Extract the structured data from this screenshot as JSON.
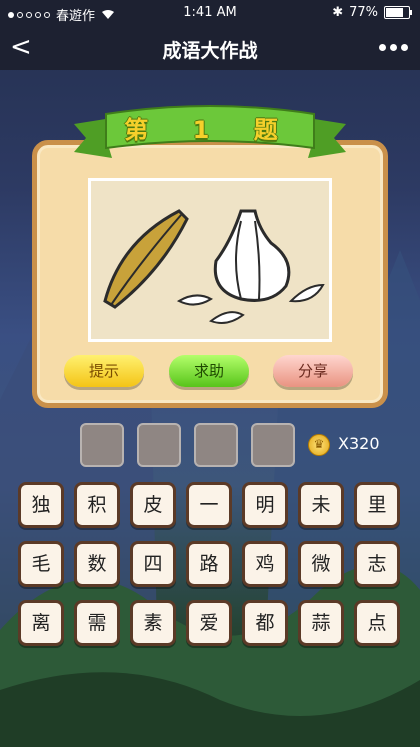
{
  "status_bar": {
    "carrier": "春遊作",
    "time": "1:41 AM",
    "battery": "77%",
    "battery_level": 0.77
  },
  "nav": {
    "back_label": "<",
    "title": "成语大作战"
  },
  "question": {
    "ribbon_label": "第 1 题"
  },
  "actions": {
    "hint": "提示",
    "help": "求助",
    "share": "分享"
  },
  "answer_slots": 4,
  "coins": {
    "label": "X320",
    "icon": "crown-coin-icon"
  },
  "tiles": [
    [
      "独",
      "积",
      "皮",
      "一",
      "明",
      "未",
      "里"
    ],
    [
      "毛",
      "数",
      "四",
      "路",
      "鸡",
      "微",
      "志"
    ],
    [
      "离",
      "需",
      "素",
      "爱",
      "都",
      "蒜",
      "点"
    ]
  ],
  "colors": {
    "board": "#f6dca9",
    "ribbon": "#6cc83a",
    "bar": "#1d2131"
  }
}
